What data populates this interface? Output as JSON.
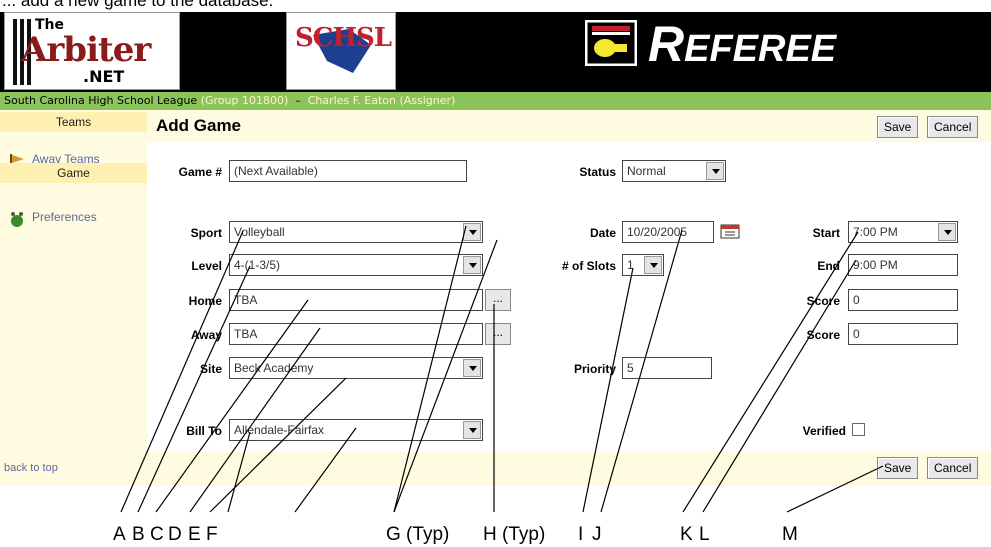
{
  "caption": "... add a new game to the database.",
  "header": {
    "arbiter_the": "The",
    "arbiter_main": "Arbiter",
    "arbiter_net": ".NET",
    "schsl": "SCHSL",
    "referee_first": "R",
    "referee_rest": "EFEREE"
  },
  "league_bar": {
    "league": "South Carolina High School League",
    "group": "(Group 101800)",
    "sep": "–",
    "assigner": "Charles F. Eaton (Assigner)"
  },
  "sidebar": {
    "teams_heading": "Teams",
    "away_teams": "Away Teams",
    "game_heading": "Game",
    "preferences": "Preferences",
    "back_to_top": "back to top"
  },
  "page": {
    "title": "Add Game",
    "save": "Save",
    "cancel": "Cancel"
  },
  "form": {
    "game_num_label": "Game #",
    "game_num_value": "(Next Available)",
    "status_label": "Status",
    "status_value": "Normal",
    "sport_label": "Sport",
    "sport_value": "Volleyball",
    "level_label": "Level",
    "level_value": "4-(1-3/5)",
    "home_label": "Home",
    "home_value": "TBA",
    "away_label": "Away",
    "away_value": "TBA",
    "site_label": "Site",
    "site_value": "Beck Academy",
    "bill_to_label": "Bill To",
    "bill_to_value": "Allendale-Fairfax",
    "date_label": "Date",
    "date_value": "10/20/2005",
    "slots_label": "# of Slots",
    "slots_value": "1",
    "priority_label": "Priority",
    "priority_value": "5",
    "start_label": "Start",
    "start_value": "7:00 PM",
    "end_label": "End",
    "end_value": "9:00 PM",
    "score_label": "Score",
    "home_score": "0",
    "away_score": "0",
    "verified_label": "Verified",
    "lookup_button": "..."
  },
  "callouts": {
    "A": "A",
    "B": "B",
    "C": "C",
    "D": "D",
    "E": "E",
    "F": "F",
    "G": "G (Typ)",
    "H": "H (Typ)",
    "I": "I",
    "J": "J",
    "K": "K",
    "L": "L",
    "M": "M"
  },
  "colors": {
    "banner": "#000000",
    "league_bar": "#8bc45a",
    "panel": "#fffbe0",
    "sidebar_heading": "#fdf0b0",
    "link": "#5a6aa0"
  }
}
